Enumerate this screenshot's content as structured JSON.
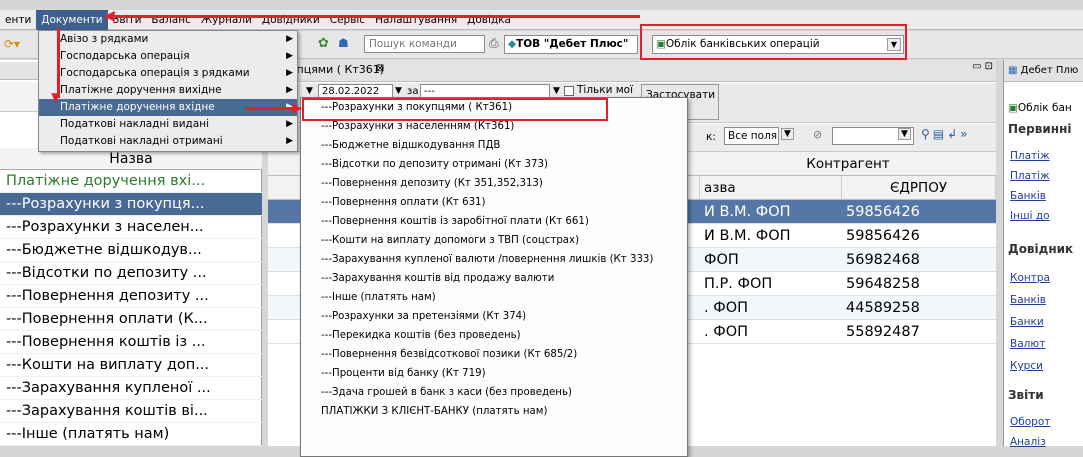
{
  "menubar": {
    "items": [
      "енти",
      "Документи",
      "Звіти",
      "Баланс",
      "Журнали",
      "Довідники",
      "Сервіс",
      "Налаштування",
      "Довідка"
    ]
  },
  "toolbar": {
    "command_placeholder": "Пошук команди",
    "org": "ТОВ \"Дебет Плюс\"",
    "module": "Облік банківських операцій"
  },
  "left_panel": {
    "column": "Назва",
    "items": [
      "Платіжне доручення вхі...",
      "---Розрахунки з покупця...",
      "---Розрахунки з населен...",
      "---Бюджетне відшкодув...",
      "---Відсотки по депозиту ...",
      "---Повернення депозиту ...",
      "---Повернення оплати (К...",
      "---Повернення коштів із ...",
      "---Кошти на виплату доп...",
      "---Зарахування купленої ...",
      "---Зарахування коштів ві...",
      "---Інше (платять нам)"
    ]
  },
  "main": {
    "tab": "упцями ( Кт361)",
    "date": "28.02.2022",
    "period_prefix": "за",
    "period_value": "---",
    "only_mine": "Тільки мої",
    "apply": "Застосувати",
    "search_prefix": "к:",
    "search_scope": "Все поля",
    "col_group": "Контрагент",
    "col_name": "азва",
    "col_code": "ЄДРПОУ",
    "rows": [
      {
        "name": "И В.М. ФОП",
        "code": "59856426"
      },
      {
        "name": "И В.М. ФОП",
        "code": "59856426"
      },
      {
        "name": "ФОП",
        "code": "56982468"
      },
      {
        "name": "П.Р. ФОП",
        "code": "59648258"
      },
      {
        "name": ". ФОП",
        "code": "44589258"
      },
      {
        "name": ". ФОП",
        "code": "55892487"
      }
    ]
  },
  "right_panel": {
    "title": "Дебет Плю",
    "subtitle": "Облік бан",
    "sec1": "Первинні",
    "links1": [
      "Платіж",
      "Платіж",
      "Банків",
      "Інші до"
    ],
    "sec2": "Довідник",
    "links2": [
      "Контра",
      "Банків",
      "Банки",
      "Валют",
      "Курси"
    ],
    "sec3": "Звіти",
    "links3": [
      "Оборот",
      "Аналіз"
    ]
  },
  "documents_menu": [
    "Авізо з рядками",
    "Господарська операція",
    "Господарська операція з рядками",
    "Платіжне доручення вихідне",
    "Платіжне доручення вхідне",
    "Податкові накладні видані",
    "Податкові накладні отримані"
  ],
  "submenu": [
    "---Розрахунки з покупцями ( Кт361)",
    "---Розрахунки з населенням (Кт361)",
    "---Бюджетне відшкодування ПДВ",
    "---Відсотки по депозиту отримані (Кт 373)",
    "---Повернення депозиту (Кт 351,352,313)",
    "---Повернення оплати (Кт 631)",
    "---Повернення коштів із заробітної плати (Кт 661)",
    "---Кошти на виплату допомоги з ТВП (соцстрах)",
    "---Зарахування купленої валюти /повернення лишків (Кт 333)",
    "---Зарахування коштів від продажу валюти",
    "---Інше (платять нам)",
    "---Розрахунки за претензіями (Кт 374)",
    "---Перекидка коштів (без проведень)",
    "---Повернення безвідсоткової позики (Кт 685/2)",
    "---Проценти від банку (Кт 719)",
    "---Здача грошей в банк з каси (без проведень)",
    "ПЛАТІЖКИ З КЛІЄНТ-БАНКУ (платять нам)"
  ],
  "colors": {
    "accent": "#4a6a96",
    "annotation": "#e0202a"
  }
}
